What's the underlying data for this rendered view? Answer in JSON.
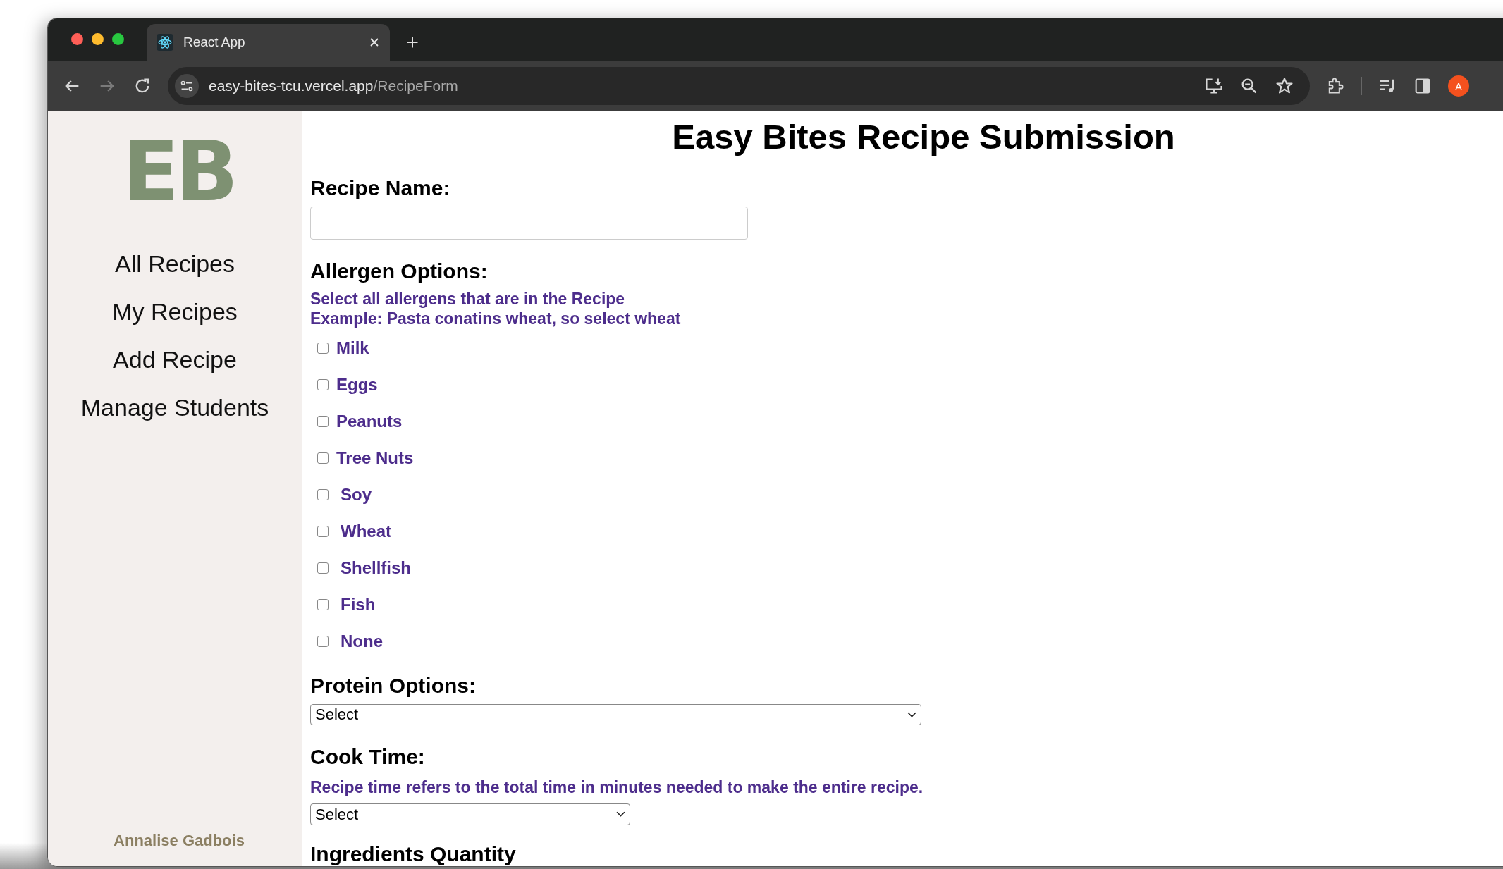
{
  "browser": {
    "tab": {
      "title": "React App",
      "selected": true
    },
    "url": {
      "host": "easy-bites-tcu.vercel.app",
      "path": "/RecipeForm"
    },
    "profile": "A"
  },
  "sidebar": {
    "logo": "EB",
    "items": [
      {
        "label": "All Recipes"
      },
      {
        "label": "My Recipes"
      },
      {
        "label": "Add Recipe"
      },
      {
        "label": "Manage Students"
      }
    ],
    "user": "Annalise Gadbois"
  },
  "form": {
    "title": "Easy Bites Recipe Submission",
    "recipe_name": {
      "label": "Recipe Name:"
    },
    "allergens": {
      "label": "Allergen Options:",
      "hints": [
        "Select all allergens that are in the Recipe",
        "Example: Pasta conatins wheat, so select wheat"
      ],
      "options": [
        {
          "label": "Milk",
          "checked": false
        },
        {
          "label": "Eggs",
          "checked": false
        },
        {
          "label": "Peanuts",
          "checked": false
        },
        {
          "label": "Tree Nuts",
          "checked": false
        },
        {
          "label": "Soy",
          "checked": false
        },
        {
          "label": "Wheat",
          "checked": false
        },
        {
          "label": "Shellfish",
          "checked": false
        },
        {
          "label": "Fish",
          "checked": false
        },
        {
          "label": "None",
          "checked": false
        }
      ]
    },
    "protein": {
      "label": "Protein Options:",
      "value": "Select"
    },
    "cook_time": {
      "label": "Cook Time:",
      "hint": "Recipe time refers to the total time in minutes needed to make the entire recipe.",
      "value": "Select"
    },
    "ingredients": {
      "label": "Ingredients Quantity"
    }
  }
}
